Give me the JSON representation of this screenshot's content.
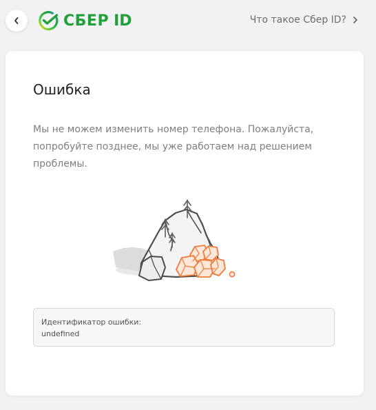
{
  "header": {
    "logo_text": "СБЕР",
    "logo_id": "ID",
    "what_is_link": "Что такое Сбер ID?"
  },
  "error": {
    "title": "Ошибка",
    "message": "Мы не можем изменить номер телефона. Пожалуйста, попробуйте позднее, мы уже работаем над решением проблемы.",
    "id_label": "Идентификатор ошибки:",
    "id_value": "undefined"
  },
  "icons": {
    "back": "chevron-left-icon",
    "link": "chevron-right-icon",
    "logo": "sber-logo-icon",
    "illustration": "rocks-illustration"
  },
  "colors": {
    "brand_green": "#21a038",
    "accent_orange": "#f07a3a",
    "background": "#f2f2f4",
    "card": "#ffffff"
  }
}
